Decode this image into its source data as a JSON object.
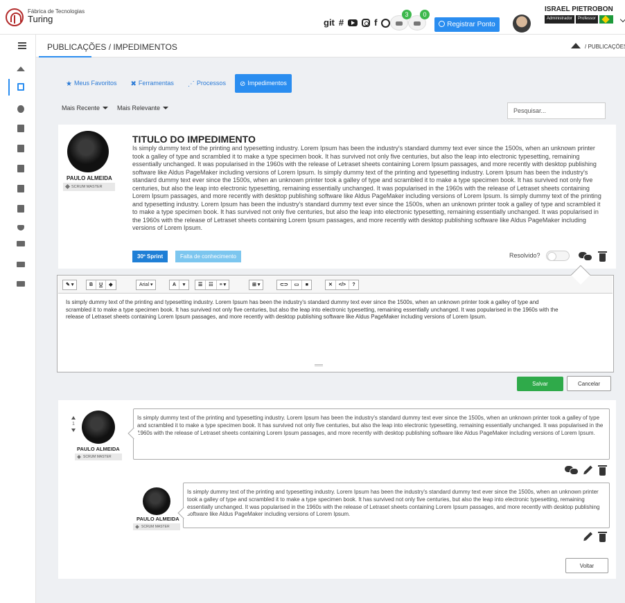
{
  "app": {
    "logo_subtitle": "Fábrica de Tecnologias",
    "logo_name": "Turing"
  },
  "header": {
    "social": {
      "git_label": "git",
      "slack_glyph": "#",
      "facebook_glyph": "f",
      "icons": [
        "git-icon",
        "slack-icon",
        "youtube-icon",
        "instagram-icon",
        "facebook-icon",
        "whatsapp-icon"
      ]
    },
    "notifications": [
      {
        "icon": "mail-icon",
        "count": "3"
      },
      {
        "icon": "bell-icon",
        "count": "0"
      }
    ],
    "register_button": "Registrar Ponto",
    "user": {
      "name": "ISRAEL PIETROBON",
      "roles": [
        "Administrador",
        "Professor"
      ]
    }
  },
  "page": {
    "title": "PUBLICAÇÕES / IMPEDIMENTOS",
    "breadcrumb": "PUBLICAÇÕES"
  },
  "sidebar": {
    "items": [
      "home-icon",
      "document-icon",
      "user-circle-icon",
      "id-card-icon",
      "calendar-icon",
      "file-icon",
      "clipboard-icon",
      "calendar-check-icon",
      "thumbs-down-icon",
      "monitor-icon",
      "car-icon",
      "truck-icon"
    ]
  },
  "tabs": [
    {
      "label": "Meus Favoritos",
      "icon": "star-icon",
      "active": false
    },
    {
      "label": "Ferramentas",
      "icon": "tools-icon",
      "active": false
    },
    {
      "label": "Processos",
      "icon": "process-icon",
      "active": false
    },
    {
      "label": "Impedimentos",
      "icon": "ban-icon",
      "active": true
    }
  ],
  "filters": {
    "recent": "Mais Recente",
    "relevant": "Mais Relevante",
    "search_placeholder": "Pesquisar..."
  },
  "post": {
    "author": "PAULO ALMEIDA",
    "role": "SCRUM MASTER",
    "title": "TITULO DO IMPEDIMENTO",
    "body": "Is simply dummy text of the printing and typesetting industry. Lorem Ipsum has been the industry's standard dummy text ever since the 1500s, when an unknown printer took a galley of type and scrambled it to make a type specimen book. It has survived not only five centuries, but also the leap into electronic typesetting, remaining essentially unchanged. It was popularised in the 1960s with the release of Letraset sheets containing Lorem Ipsum passages, and more recently with desktop publishing software like Aldus PageMaker including versions of Lorem Ipsum. Is simply dummy text of the printing and typesetting industry. Lorem Ipsum has been the industry's standard dummy text ever since the 1500s, when an unknown printer took a galley of type and scrambled it to make a type specimen book. It has survived not only five centuries, but also the leap into electronic typesetting, remaining essentially unchanged. It was popularised in the 1960s with the release of Letraset sheets containing Lorem Ipsum passages, and more recently with desktop publishing software like Aldus PageMaker including versions of Lorem Ipsum. Is simply dummy text of the printing and typesetting industry. Lorem Ipsum has been the industry's standard dummy text ever since the 1500s, when an unknown printer took a galley of type and scrambled it to make a type specimen book. It has survived not only five centuries, but also the leap into electronic typesetting, remaining essentially unchanged. It was popularised in the 1960s with the release of Letraset sheets containing Lorem Ipsum passages, and more recently with desktop publishing software like Aldus PageMaker including versions of Lorem Ipsum.",
    "tags": [
      "30º Sprint",
      "Falta de conhecimento"
    ],
    "resolved_label": "Resolvido?",
    "resolved": false
  },
  "editor": {
    "toolbar": {
      "style": "✎",
      "bold": "B",
      "underline": "U",
      "clear": "◆",
      "font": "Arial",
      "color": "A",
      "ul": "☰",
      "ol": "☷",
      "align": "≡",
      "table": "⊞",
      "link": "⊂⊃",
      "image": "▭",
      "video": "■",
      "fullscreen": "✕",
      "code": "</>",
      "help": "?",
      "dropdown": "▾"
    },
    "content": "Is simply dummy text of the printing and typesetting industry. Lorem Ipsum has been the industry's standard dummy text ever since the 1500s, when an unknown printer took a galley of type and scrambled it to make a type specimen book. It has survived not only five centuries, but also the leap into electronic typesetting, remaining essentially unchanged. It was popularised in the 1960s with the release of Letraset sheets containing Lorem Ipsum passages, and more recently with desktop publishing software like Aldus PageMaker including versions of Lorem Ipsum.",
    "save_label": "Salvar",
    "cancel_label": "Cancelar"
  },
  "comments": [
    {
      "author": "PAULO ALMEIDA",
      "role": "SCRUM MASTER",
      "votes": "1",
      "text": "Is simply dummy text of the printing and typesetting industry. Lorem Ipsum has been the industry's standard dummy text ever since the 1500s, when an unknown printer took a galley of type and scrambled it to make a type specimen book. It has survived not only five centuries, but also the leap into electronic typesetting, remaining essentially unchanged. It was popularised in the 1960s with the release of Letraset sheets containing Lorem Ipsum passages, and more recently with desktop publishing software like Aldus PageMaker including versions of Lorem Ipsum."
    },
    {
      "author": "PAULO ALMEIDA",
      "role": "SCRUM MASTER",
      "text": "Is simply dummy text of the printing and typesetting industry. Lorem Ipsum has been the industry's standard dummy text ever since the 1500s, when an unknown printer took a galley of type and scrambled it to make a type specimen book. It has survived not only five centuries, but also the leap into electronic typesetting, remaining essentially unchanged. It was popularised in the 1960s with the release of Letraset sheets containing Lorem Ipsum passages, and more recently with desktop publishing software like Aldus PageMaker including versions of Lorem Ipsum."
    }
  ],
  "back_label": "Voltar",
  "colors": {
    "primary": "#2a8df0",
    "success": "#2faa4a",
    "sprint_tag": "#1f7fd6",
    "knowledge_tag": "#7cc6ef",
    "brand": "#b22a2a"
  }
}
